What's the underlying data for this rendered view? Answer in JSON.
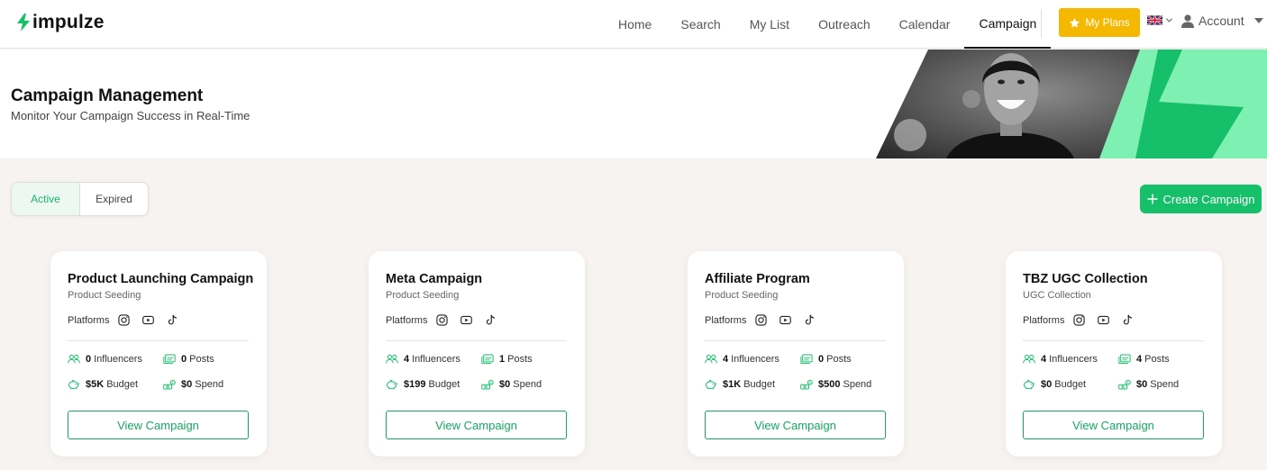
{
  "brand": {
    "name": "impulze",
    "accent": "#16c06a",
    "plans_color": "#f5b800"
  },
  "nav": {
    "links": [
      "Home",
      "Search",
      "My List",
      "Outreach",
      "Calendar",
      "Campaign"
    ],
    "active": "Campaign",
    "plans_label": "My Plans",
    "account_label": "Account",
    "language_icon": "uk-flag-icon"
  },
  "hero": {
    "title": "Campaign Management",
    "subtitle": "Monitor Your Campaign Success in Real-Time"
  },
  "tabs": {
    "active": "Active",
    "expired": "Expired"
  },
  "create_label": "Create Campaign",
  "platforms_label": "Platforms",
  "view_label": "View Campaign",
  "stat_labels": {
    "influencers": "Influencers",
    "posts": "Posts",
    "budget": "Budget",
    "spend": "Spend"
  },
  "campaigns": [
    {
      "title": "Product Launching Campaign",
      "type": "Product Seeding",
      "influencers": "0",
      "posts": "0",
      "budget": "$5K",
      "spend": "$0"
    },
    {
      "title": "Meta Campaign",
      "type": "Product Seeding",
      "influencers": "4",
      "posts": "1",
      "budget": "$199",
      "spend": "$0"
    },
    {
      "title": "Affiliate Program",
      "type": "Product Seeding",
      "influencers": "4",
      "posts": "0",
      "budget": "$1K",
      "spend": "$500"
    },
    {
      "title": "TBZ UGC Collection",
      "type": "UGC Collection",
      "influencers": "4",
      "posts": "4",
      "budget": "$0",
      "spend": "$0"
    }
  ]
}
